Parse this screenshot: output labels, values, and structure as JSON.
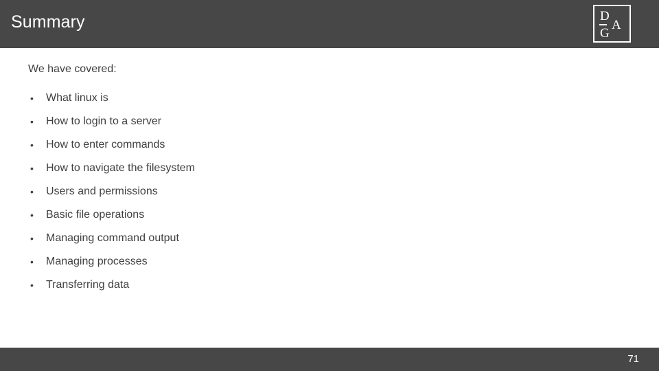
{
  "header": {
    "title": "Summary",
    "background_color": "#474747",
    "title_color": "#ffffff"
  },
  "logo": {
    "letter_top": "D",
    "letter_middle": "A",
    "letter_bottom": "G",
    "border_color": "#ffffff"
  },
  "body": {
    "intro": "We have covered:",
    "text_color": "#404040",
    "bullet_glyph": "•",
    "bullets": [
      {
        "label": "What linux is"
      },
      {
        "label": "How to login to a server"
      },
      {
        "label": "How to enter commands"
      },
      {
        "label": "How to navigate the filesystem"
      },
      {
        "label": "Users and permissions"
      },
      {
        "label": "Basic file operations"
      },
      {
        "label": "Managing command output"
      },
      {
        "label": "Managing processes"
      },
      {
        "label": "Transferring data"
      }
    ]
  },
  "footer": {
    "page_number": "71",
    "background_color": "#474747",
    "text_color": "#ffffff"
  }
}
